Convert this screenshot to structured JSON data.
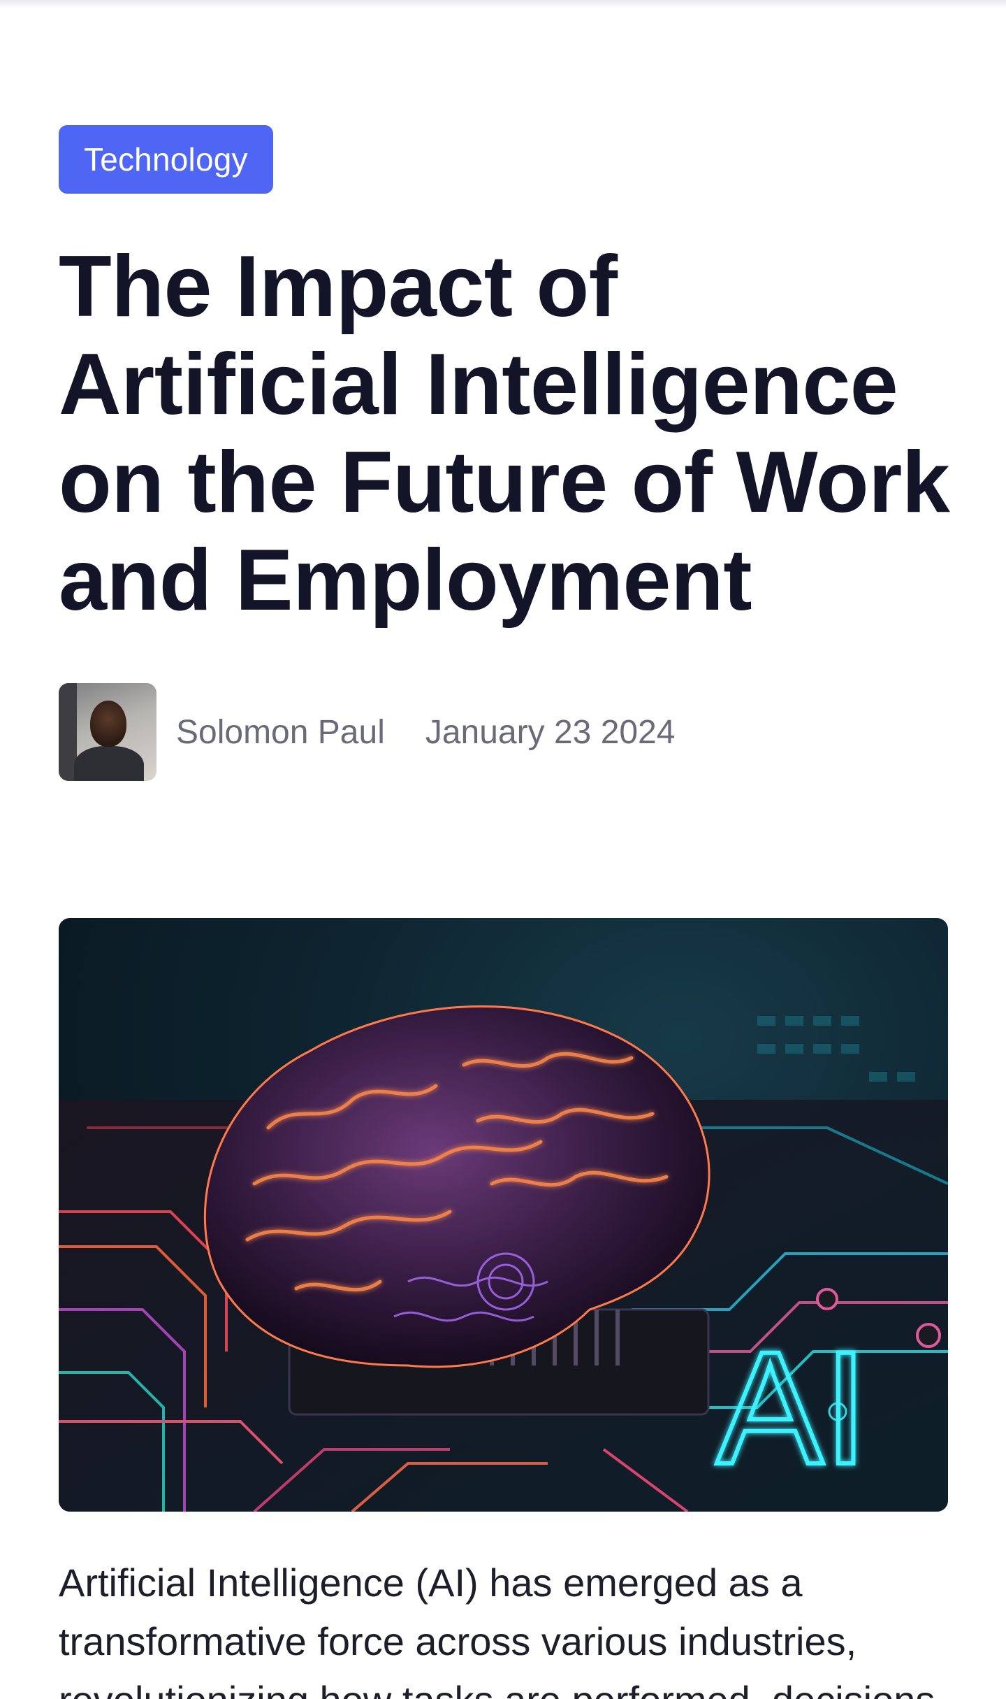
{
  "article": {
    "category": "Technology",
    "title": "The Impact of Artificial Intelligence on the Future of Work and Employment",
    "author": "Solomon Paul",
    "date": "January 23 2024",
    "hero_image_text": "AI",
    "intro": "Artificial Intelligence (AI) has emerged as a transformative force across various industries, revolutionizing how tasks are performed, decisions"
  },
  "colors": {
    "badge_bg": "#4f66f5",
    "title": "#141428",
    "meta": "#6a6a78"
  },
  "icons": {
    "avatar": "author-avatar-photo"
  }
}
